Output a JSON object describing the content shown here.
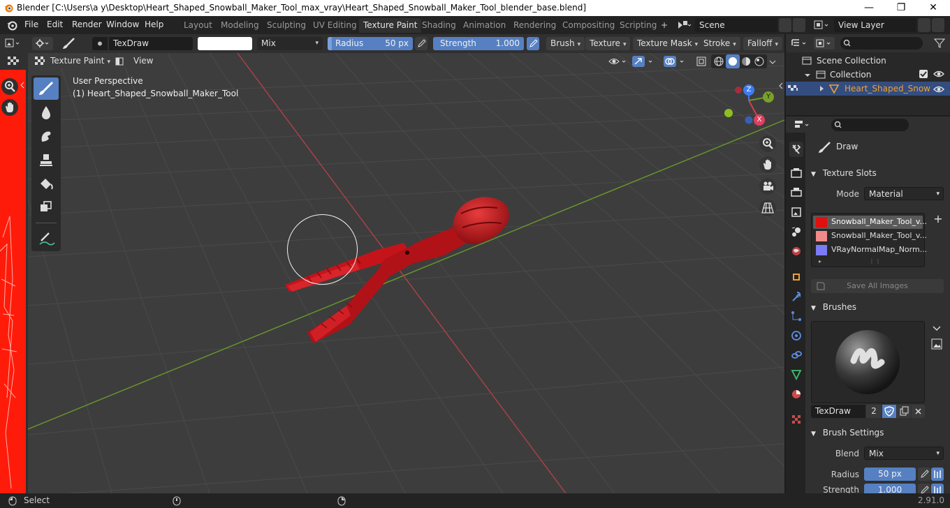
{
  "window": {
    "title": "Blender [C:\\Users\\a y\\Desktop\\Heart_Shaped_Snowball_Maker_Tool_max_vray\\Heart_Shaped_Snowball_Maker_Tool_blender_base.blend]",
    "minimize": "—",
    "maximize": "❐",
    "close": "✕"
  },
  "menu": [
    "File",
    "Edit",
    "Render",
    "Window",
    "Help"
  ],
  "workspaces": [
    "Layout",
    "Modeling",
    "Sculpting",
    "UV Editing",
    "Texture Paint",
    "Shading",
    "Animation",
    "Rendering",
    "Compositing",
    "Scripting"
  ],
  "workspace_add": "+",
  "scene": {
    "name": "Scene",
    "view_layer": "View Layer"
  },
  "tool_header": {
    "brush_name": "TexDraw",
    "blend": "Mix",
    "radius_label": "Radius",
    "radius_value": "50 px",
    "strength_label": "Strength",
    "strength_value": "1.000",
    "strength_fraction": 1.0,
    "menus": [
      "Brush",
      "Texture",
      "Texture Mask",
      "Stroke",
      "Falloff"
    ],
    "mode": "Texture Paint",
    "view": "View"
  },
  "viewport": {
    "perspective": "User Perspective",
    "object": "(1) Heart_Shaped_Snowball_Maker_Tool",
    "gizmo": {
      "x": "X",
      "y": "Y",
      "z": "Z"
    }
  },
  "outliner": {
    "scene_collection": "Scene Collection",
    "collection": "Collection",
    "object": "Heart_Shaped_Snow"
  },
  "properties": {
    "active_tool": "Draw",
    "texture_slots": {
      "title": "Texture Slots",
      "mode_label": "Mode",
      "mode_value": "Material",
      "slots": [
        {
          "name": "Snowball_Maker_Tool_v...",
          "color": "#e01010"
        },
        {
          "name": "Snowball_Maker_Tool_v...",
          "color": "#f08a8a"
        },
        {
          "name": "VRayNormalMap_Norm...",
          "color": "#7b7bf5"
        }
      ],
      "save_all": "Save All Images",
      "add": "+"
    },
    "brushes": {
      "title": "Brushes",
      "brush_name": "TexDraw",
      "users": "2"
    },
    "brush_settings": {
      "title": "Brush Settings",
      "blend_label": "Blend",
      "blend_value": "Mix",
      "radius_label": "Radius",
      "radius_value": "50 px",
      "strength_label": "Strength",
      "strength_value": "1.000"
    }
  },
  "status": {
    "left": "Select",
    "version": "2.91.0"
  },
  "colors": {
    "accent": "#5680c2",
    "model": "#c4141a",
    "x_axis": "#d04050",
    "y_axis": "#7aa02a"
  }
}
